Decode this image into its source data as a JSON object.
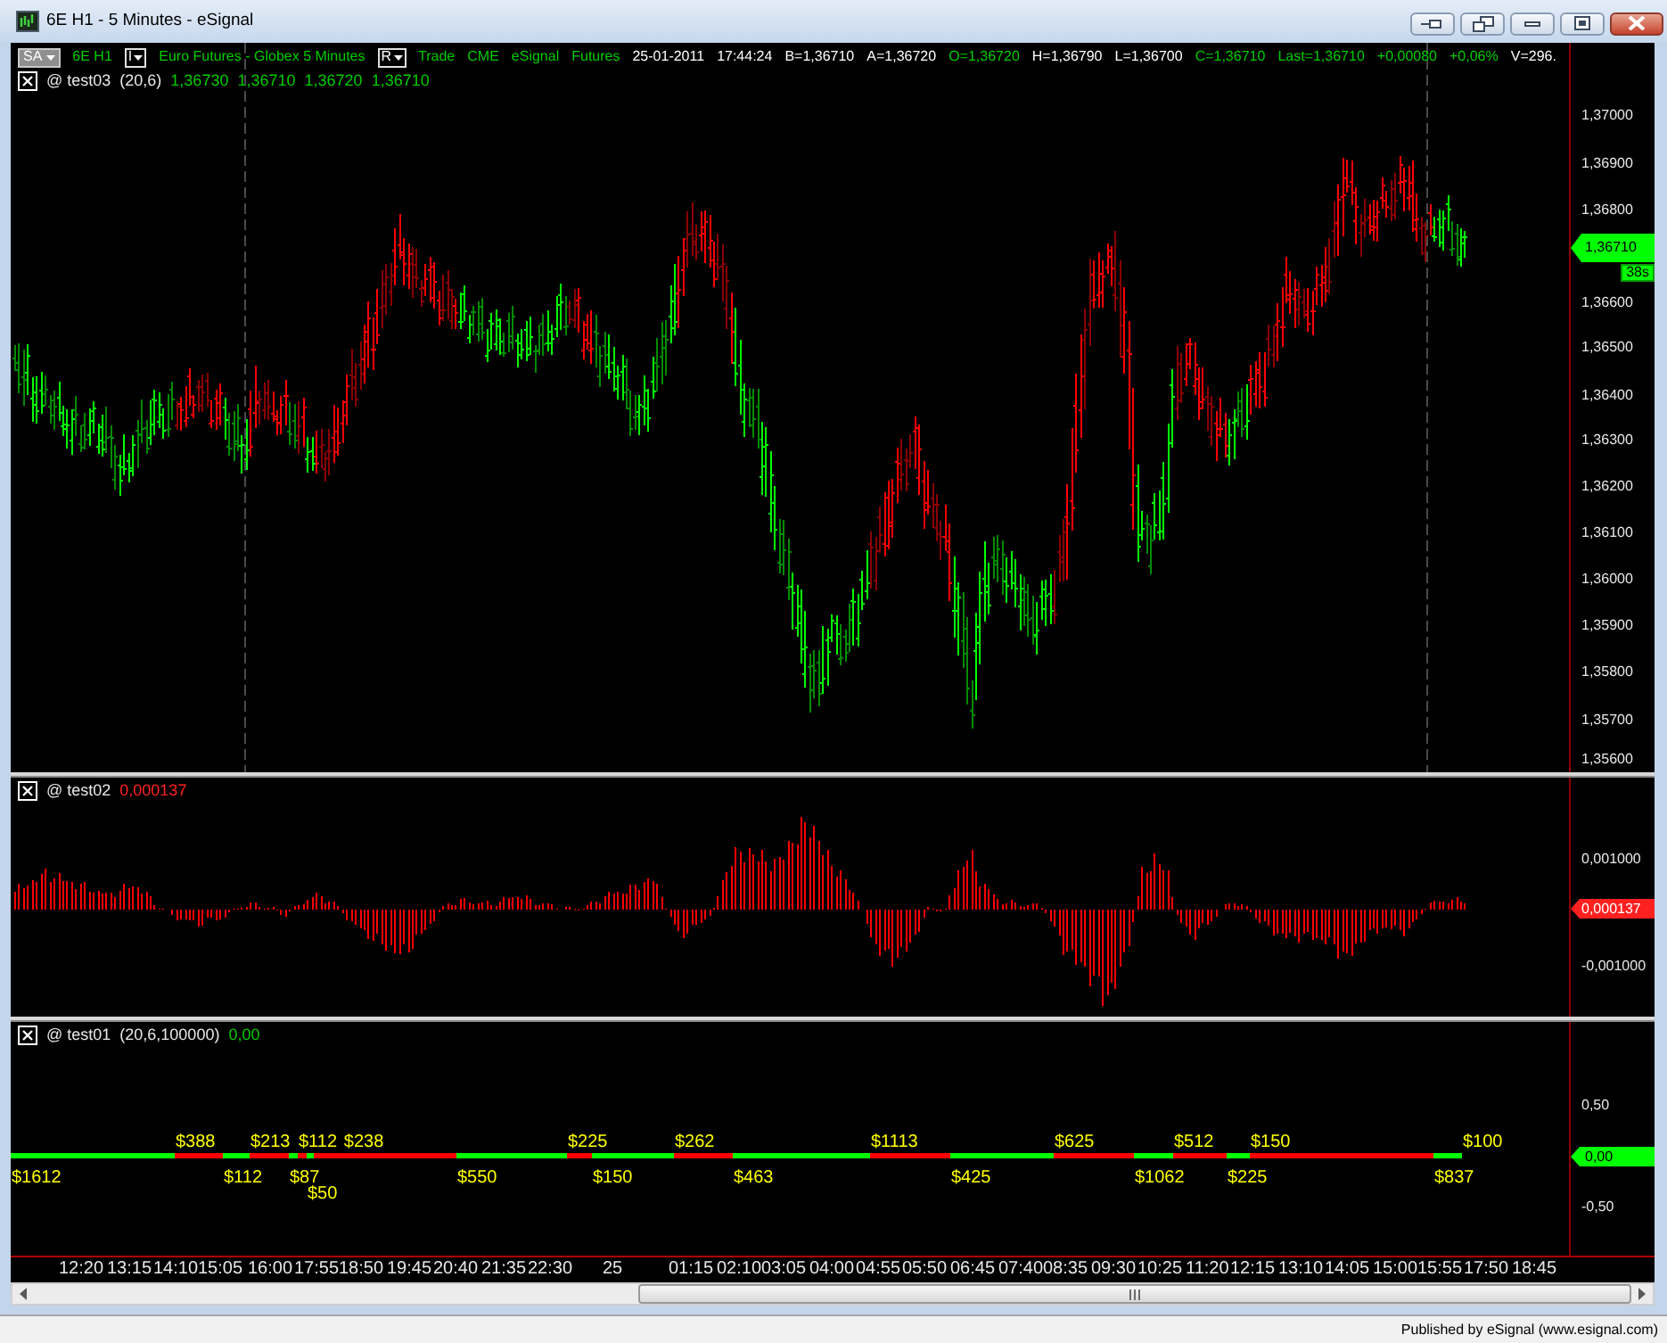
{
  "window": {
    "title": "6E H1 - 5 Minutes - eSignal"
  },
  "symbol_bar": {
    "layout_button": "SA",
    "symbol": "6E H1",
    "interval_button": "I",
    "description": "Euro Futures - Globex 5 Minutes",
    "bar_type_button": "R",
    "fields": [
      {
        "text": "Trade",
        "color": "#00cc00"
      },
      {
        "text": "CME",
        "color": "#00cc00"
      },
      {
        "text": "eSignal",
        "color": "#00cc00"
      },
      {
        "text": "Futures",
        "color": "#00cc00"
      },
      {
        "text": "25-01-2011",
        "color": "#ffffff"
      },
      {
        "text": "17:44:24",
        "color": "#ffffff"
      },
      {
        "text": "B=1,36710",
        "color": "#ffffff"
      },
      {
        "text": "A=1,36720",
        "color": "#ffffff"
      },
      {
        "text": "O=1,36720",
        "color": "#00cc00"
      },
      {
        "text": "H=1,36790",
        "color": "#ffffff"
      },
      {
        "text": "L=1,36700",
        "color": "#ffffff"
      },
      {
        "text": "C=1,36710",
        "color": "#00cc00"
      },
      {
        "text": "Last=1,36710",
        "color": "#00cc00"
      },
      {
        "text": "+0,00080",
        "color": "#00cc00"
      },
      {
        "text": "+0,06%",
        "color": "#00cc00"
      },
      {
        "text": "V=296.",
        "color": "#ffffff"
      }
    ]
  },
  "price_panel": {
    "study": {
      "name": "@ test03",
      "params": "(20,6)",
      "values": [
        "1,36730",
        "1,36710",
        "1,36720",
        "1,36710"
      ]
    },
    "axis_ticks": [
      "1,37000",
      "1,36900",
      "1,36800",
      "1,36600",
      "1,36500",
      "1,36400",
      "1,36300",
      "1,36200",
      "1,36100",
      "1,36000",
      "1,35900",
      "1,35800",
      "1,35700",
      "1,35600"
    ],
    "last_price": "1,36710",
    "countdown": "38s"
  },
  "oscillator_panel": {
    "study": {
      "name": "@ test02",
      "values": [
        "0,000137"
      ]
    },
    "axis_ticks": [
      "0,001000",
      "-0,001000"
    ],
    "last_value": "0,000137"
  },
  "equity_panel": {
    "study": {
      "name": "@ test01",
      "params": "(20,6,100000)",
      "values": [
        "0,00"
      ]
    },
    "axis_ticks": [
      "0,50",
      "-0,50"
    ],
    "last_value": "0,00",
    "trades": [
      {
        "color": "#00ff00",
        "label": "$1612",
        "kind": "below"
      },
      {
        "color": "#ff0000",
        "label": "$388",
        "kind": "above"
      },
      {
        "color": "#00ff00",
        "label": "$112",
        "kind": "below"
      },
      {
        "color": "#ff0000",
        "label": "$213",
        "kind": "above"
      },
      {
        "color": "#00ff00",
        "label": "$87",
        "kind": "below"
      },
      {
        "color": "#ff0000",
        "label": "$112",
        "kind": "above"
      },
      {
        "color": "#00ff00",
        "label": "$50",
        "kind": "below"
      },
      {
        "color": "#ff0000",
        "label": "$238",
        "kind": "above"
      },
      {
        "color": "#00ff00",
        "label": "$550",
        "kind": "below"
      },
      {
        "color": "#ff0000",
        "label": "$225",
        "kind": "above"
      },
      {
        "color": "#00ff00",
        "label": "$150",
        "kind": "below"
      },
      {
        "color": "#ff0000",
        "label": "$262",
        "kind": "above"
      },
      {
        "color": "#00ff00",
        "label": "$463",
        "kind": "below"
      },
      {
        "color": "#ff0000",
        "label": "$1113",
        "kind": "above"
      },
      {
        "color": "#00ff00",
        "label": "$425",
        "kind": "below"
      },
      {
        "color": "#ff0000",
        "label": "$625",
        "kind": "above"
      },
      {
        "color": "#00ff00",
        "label": "$1062",
        "kind": "below"
      },
      {
        "color": "#ff0000",
        "label": "$512",
        "kind": "above"
      },
      {
        "color": "#00ff00",
        "label": "$225",
        "kind": "below"
      },
      {
        "color": "#ff0000",
        "label": "$150",
        "kind": "above"
      },
      {
        "color": "#00ff00",
        "label": "$837",
        "kind": "below"
      },
      {
        "label": "$100",
        "kind": "above"
      }
    ]
  },
  "time_axis": {
    "labels": [
      "12:20",
      "13:15",
      "14:10",
      "15:05",
      "16:00",
      "17:55",
      "18:50",
      "19:45",
      "20:40",
      "21:35",
      "22:30",
      "25",
      "01:15",
      "02:10",
      "03:05",
      "04:00",
      "04:55",
      "05:50",
      "06:45",
      "07:40",
      "08:35",
      "09:30",
      "10:25",
      "11:20",
      "12:15",
      "13:10",
      "14:05",
      "15:00",
      "15:55",
      "17:50",
      "18:45"
    ]
  },
  "status_bar": {
    "text": "Published by eSignal (www.esignal.com)"
  }
}
